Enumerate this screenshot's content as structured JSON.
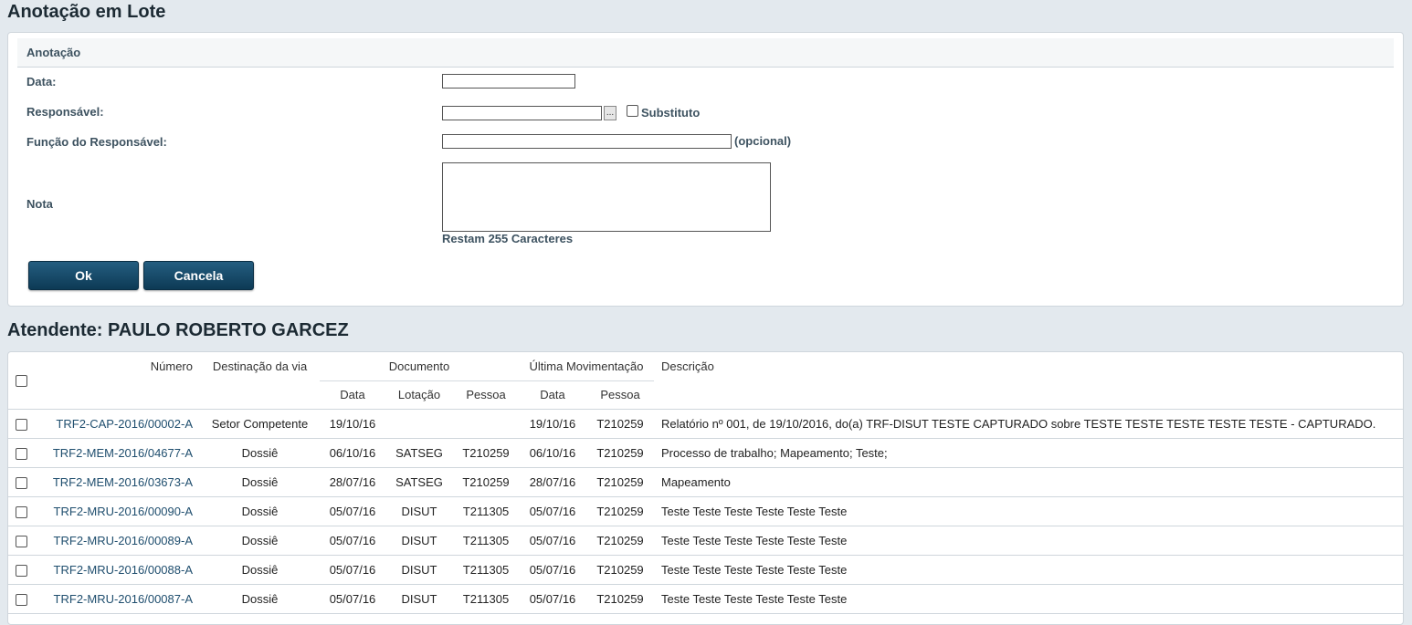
{
  "page": {
    "title": "Anotação em Lote"
  },
  "form": {
    "legend": "Anotação",
    "data_label": "Data:",
    "data_value": "",
    "responsavel_label": "Responsável:",
    "responsavel_value": "",
    "browse_label": "...",
    "substituto_label": "Substituto",
    "funcao_label": "Função do Responsável:",
    "funcao_value": "",
    "opcional_label": "(opcional)",
    "nota_label": "Nota",
    "nota_value": "",
    "restam_label": "Restam 255 Caracteres",
    "ok_label": "Ok",
    "cancela_label": "Cancela"
  },
  "atendente": {
    "title": "Atendente: PAULO ROBERTO GARCEZ"
  },
  "table": {
    "headers": {
      "numero": "Número",
      "destinacao": "Destinação da via",
      "documento": "Documento",
      "ultima_mov": "Última Movimentação",
      "descricao": "Descrição",
      "doc_data": "Data",
      "doc_lotacao": "Lotação",
      "doc_pessoa": "Pessoa",
      "mov_data": "Data",
      "mov_pessoa": "Pessoa"
    },
    "rows": [
      {
        "numero": "TRF2-CAP-2016/00002-A",
        "destinacao": "Setor Competente",
        "doc_data": "19/10/16",
        "doc_lotacao": "",
        "doc_pessoa": "",
        "mov_data": "19/10/16",
        "mov_pessoa": "T210259",
        "descricao": "Relatório nº 001, de 19/10/2016, do(a) TRF-DISUT TESTE CAPTURADO sobre TESTE TESTE TESTE TESTE TESTE - CAPTURADO."
      },
      {
        "numero": "TRF2-MEM-2016/04677-A",
        "destinacao": "Dossiê",
        "doc_data": "06/10/16",
        "doc_lotacao": "SATSEG",
        "doc_pessoa": "T210259",
        "mov_data": "06/10/16",
        "mov_pessoa": "T210259",
        "descricao": "Processo de trabalho; Mapeamento; Teste;"
      },
      {
        "numero": "TRF2-MEM-2016/03673-A",
        "destinacao": "Dossiê",
        "doc_data": "28/07/16",
        "doc_lotacao": "SATSEG",
        "doc_pessoa": "T210259",
        "mov_data": "28/07/16",
        "mov_pessoa": "T210259",
        "descricao": "Mapeamento"
      },
      {
        "numero": "TRF2-MRU-2016/00090-A",
        "destinacao": "Dossiê",
        "doc_data": "05/07/16",
        "doc_lotacao": "DISUT",
        "doc_pessoa": "T211305",
        "mov_data": "05/07/16",
        "mov_pessoa": "T210259",
        "descricao": "Teste Teste Teste Teste Teste Teste"
      },
      {
        "numero": "TRF2-MRU-2016/00089-A",
        "destinacao": "Dossiê",
        "doc_data": "05/07/16",
        "doc_lotacao": "DISUT",
        "doc_pessoa": "T211305",
        "mov_data": "05/07/16",
        "mov_pessoa": "T210259",
        "descricao": "Teste Teste Teste Teste Teste Teste"
      },
      {
        "numero": "TRF2-MRU-2016/00088-A",
        "destinacao": "Dossiê",
        "doc_data": "05/07/16",
        "doc_lotacao": "DISUT",
        "doc_pessoa": "T211305",
        "mov_data": "05/07/16",
        "mov_pessoa": "T210259",
        "descricao": "Teste Teste Teste Teste Teste Teste"
      },
      {
        "numero": "TRF2-MRU-2016/00087-A",
        "destinacao": "Dossiê",
        "doc_data": "05/07/16",
        "doc_lotacao": "DISUT",
        "doc_pessoa": "T211305",
        "mov_data": "05/07/16",
        "mov_pessoa": "T210259",
        "descricao": "Teste Teste Teste Teste Teste Teste"
      },
      {
        "numero": "",
        "destinacao": "",
        "doc_data": "",
        "doc_lotacao": "",
        "doc_pessoa": "",
        "mov_data": "",
        "mov_pessoa": "",
        "descricao": ""
      }
    ]
  },
  "colors": {
    "background": "#e3e9ee",
    "label": "#3d5260",
    "link": "#1f4e6e",
    "button": "#0d3a55"
  }
}
